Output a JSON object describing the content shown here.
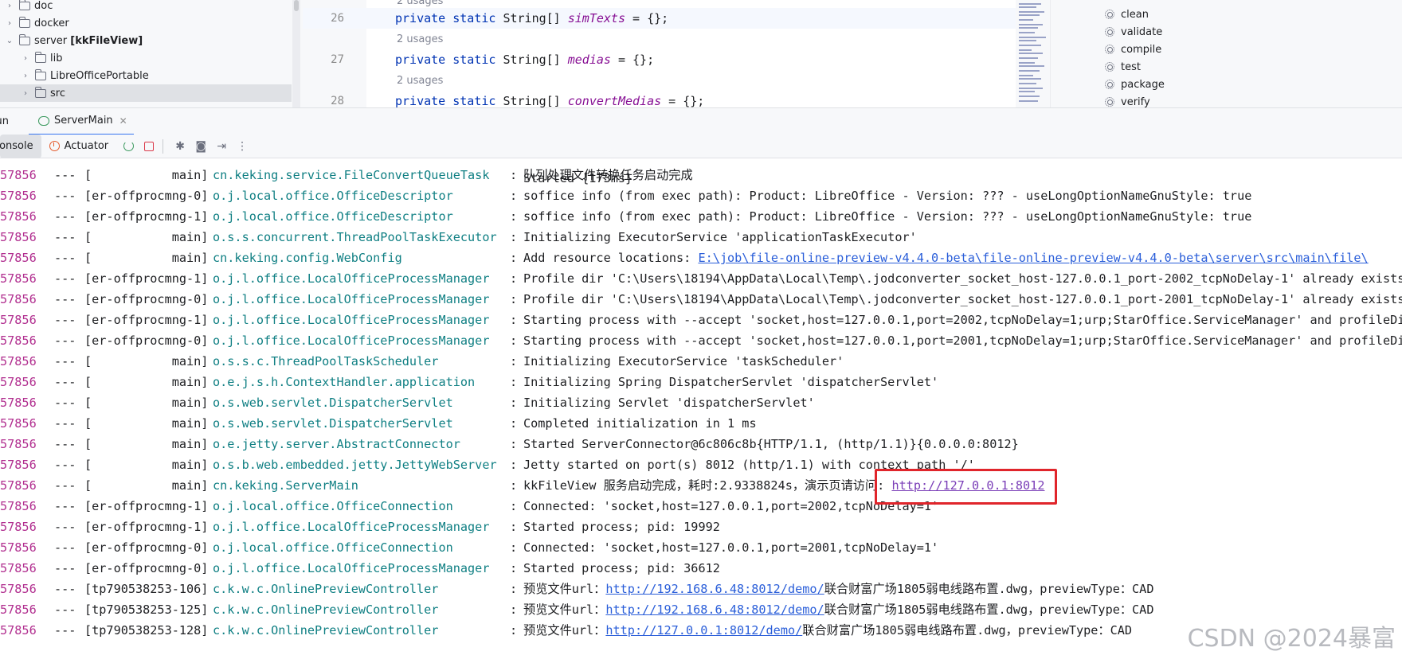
{
  "project_tree": {
    "items": [
      {
        "label": "doc",
        "bold": ""
      },
      {
        "label": "docker",
        "bold": ""
      },
      {
        "label": "server",
        "bold": "[kkFileView]"
      },
      {
        "label": "lib",
        "bold": ""
      },
      {
        "label": "LibreOfficePortable",
        "bold": ""
      },
      {
        "label": "src",
        "bold": ""
      }
    ]
  },
  "editor": {
    "usages_top": "2 usages",
    "lines": [
      {
        "num": "26",
        "kw": "private static",
        "type": "String[]",
        "field": "simTexts",
        "rest": " = {};"
      },
      {
        "num": "27",
        "kw": "private static",
        "type": "String[]",
        "field": "medias",
        "rest": " = {};"
      },
      {
        "num": "28",
        "kw": "private static",
        "type": "String[]",
        "field": "convertMedias",
        "rest": " = {};"
      }
    ],
    "usages": [
      "2 usages",
      "2 usages"
    ]
  },
  "maven": {
    "lifecycle": [
      "clean",
      "validate",
      "compile",
      "test",
      "package",
      "verify"
    ]
  },
  "run_window": {
    "left_tab": "Run",
    "tab_label": "ServerMain",
    "console_tab": "Console",
    "actuator_tab": "Actuator"
  },
  "log_partial_top": "Started {173ms}",
  "log": [
    {
      "pid": "57856",
      "thread": "[           main]",
      "logger": "cn.keking.service.FileConvertQueueTask",
      "msg": "队列处理文件转换任务启动完成",
      "link": "",
      "tail": ""
    },
    {
      "pid": "57856",
      "thread": "[er-offprocmng-0]",
      "logger": "o.j.local.office.OfficeDescriptor",
      "msg": "soffice info (from exec path): Product: LibreOffice - Version: ??? - useLongOptionNameGnuStyle: true",
      "link": "",
      "tail": ""
    },
    {
      "pid": "57856",
      "thread": "[er-offprocmng-1]",
      "logger": "o.j.local.office.OfficeDescriptor",
      "msg": "soffice info (from exec path): Product: LibreOffice - Version: ??? - useLongOptionNameGnuStyle: true",
      "link": "",
      "tail": ""
    },
    {
      "pid": "57856",
      "thread": "[           main]",
      "logger": "o.s.s.concurrent.ThreadPoolTaskExecutor",
      "msg": "Initializing ExecutorService 'applicationTaskExecutor'",
      "link": "",
      "tail": ""
    },
    {
      "pid": "57856",
      "thread": "[           main]",
      "logger": "cn.keking.config.WebConfig",
      "msg": "Add resource locations: ",
      "link": "E:\\job\\file-online-preview-v4.4.0-beta\\file-online-preview-v4.4.0-beta\\server\\src\\main\\file\\",
      "tail": ""
    },
    {
      "pid": "57856",
      "thread": "[er-offprocmng-1]",
      "logger": "o.j.l.office.LocalOfficeProcessManager",
      "msg": "Profile dir 'C:\\Users\\18194\\AppData\\Local\\Temp\\.jodconverter_socket_host-127.0.0.1_port-2002_tcpNoDelay-1' already exists;",
      "link": "",
      "tail": ""
    },
    {
      "pid": "57856",
      "thread": "[er-offprocmng-0]",
      "logger": "o.j.l.office.LocalOfficeProcessManager",
      "msg": "Profile dir 'C:\\Users\\18194\\AppData\\Local\\Temp\\.jodconverter_socket_host-127.0.0.1_port-2001_tcpNoDelay-1' already exists;",
      "link": "",
      "tail": ""
    },
    {
      "pid": "57856",
      "thread": "[er-offprocmng-1]",
      "logger": "o.j.l.office.LocalOfficeProcessManager",
      "msg": "Starting process with --accept 'socket,host=127.0.0.1,port=2002,tcpNoDelay=1;urp;StarOffice.ServiceManager' and profileDir",
      "link": "",
      "tail": ""
    },
    {
      "pid": "57856",
      "thread": "[er-offprocmng-0]",
      "logger": "o.j.l.office.LocalOfficeProcessManager",
      "msg": "Starting process with --accept 'socket,host=127.0.0.1,port=2001,tcpNoDelay=1;urp;StarOffice.ServiceManager' and profileDir",
      "link": "",
      "tail": ""
    },
    {
      "pid": "57856",
      "thread": "[           main]",
      "logger": "o.s.s.c.ThreadPoolTaskScheduler",
      "msg": "Initializing ExecutorService 'taskScheduler'",
      "link": "",
      "tail": ""
    },
    {
      "pid": "57856",
      "thread": "[           main]",
      "logger": "o.e.j.s.h.ContextHandler.application",
      "msg": "Initializing Spring DispatcherServlet 'dispatcherServlet'",
      "link": "",
      "tail": ""
    },
    {
      "pid": "57856",
      "thread": "[           main]",
      "logger": "o.s.web.servlet.DispatcherServlet",
      "msg": "Initializing Servlet 'dispatcherServlet'",
      "link": "",
      "tail": ""
    },
    {
      "pid": "57856",
      "thread": "[           main]",
      "logger": "o.s.web.servlet.DispatcherServlet",
      "msg": "Completed initialization in 1 ms",
      "link": "",
      "tail": ""
    },
    {
      "pid": "57856",
      "thread": "[           main]",
      "logger": "o.e.jetty.server.AbstractConnector",
      "msg": "Started ServerConnector@6c806c8b{HTTP/1.1, (http/1.1)}{0.0.0.0:8012}",
      "link": "",
      "tail": ""
    },
    {
      "pid": "57856",
      "thread": "[           main]",
      "logger": "o.s.b.web.embedded.jetty.JettyWebServer",
      "msg": "Jetty started on port(s) 8012 (http/1.1) with context path '/'",
      "link": "",
      "tail": ""
    },
    {
      "pid": "57856",
      "thread": "[           main]",
      "logger": "cn.keking.ServerMain",
      "msg": "kkFileView 服务启动完成，耗时:2.9338824s，演示页请访问: ",
      "link": "http://127.0.0.1:8012",
      "tail": ""
    },
    {
      "pid": "57856",
      "thread": "[er-offprocmng-1]",
      "logger": "o.j.local.office.OfficeConnection",
      "msg": "Connected: 'socket,host=127.0.0.1,port=2002,tcpNoDelay=1'",
      "link": "",
      "tail": ""
    },
    {
      "pid": "57856",
      "thread": "[er-offprocmng-1]",
      "logger": "o.j.l.office.LocalOfficeProcessManager",
      "msg": "Started process; pid: 19992",
      "link": "",
      "tail": ""
    },
    {
      "pid": "57856",
      "thread": "[er-offprocmng-0]",
      "logger": "o.j.local.office.OfficeConnection",
      "msg": "Connected: 'socket,host=127.0.0.1,port=2001,tcpNoDelay=1'",
      "link": "",
      "tail": ""
    },
    {
      "pid": "57856",
      "thread": "[er-offprocmng-0]",
      "logger": "o.j.l.office.LocalOfficeProcessManager",
      "msg": "Started process; pid: 36612",
      "link": "",
      "tail": ""
    },
    {
      "pid": "57856",
      "thread": "[tp790538253-106]",
      "logger": "c.k.w.c.OnlinePreviewController",
      "msg": "预览文件url：",
      "link": "http://192.168.6.48:8012/demo/",
      "tail": "联合财富广场1805弱电线路布置.dwg，previewType：CAD"
    },
    {
      "pid": "57856",
      "thread": "[tp790538253-125]",
      "logger": "c.k.w.c.OnlinePreviewController",
      "msg": "预览文件url：",
      "link": "http://192.168.6.48:8012/demo/",
      "tail": "联合财富广场1805弱电线路布置.dwg，previewType：CAD"
    },
    {
      "pid": "57856",
      "thread": "[tp790538253-128]",
      "logger": "c.k.w.c.OnlinePreviewController",
      "msg": "预览文件url：",
      "link": "http://127.0.0.1:8012/demo/",
      "tail": "联合财富广场1805弱电线路布置.dwg，previewType：CAD"
    }
  ],
  "log_sep": "---",
  "log_colon": ":",
  "watermark": "CSDN @2024暴富",
  "colors": {
    "pid": "#b12e8f",
    "logger": "#0f7f83",
    "link": "#2a5ed9",
    "highlight": "#e0252b"
  }
}
